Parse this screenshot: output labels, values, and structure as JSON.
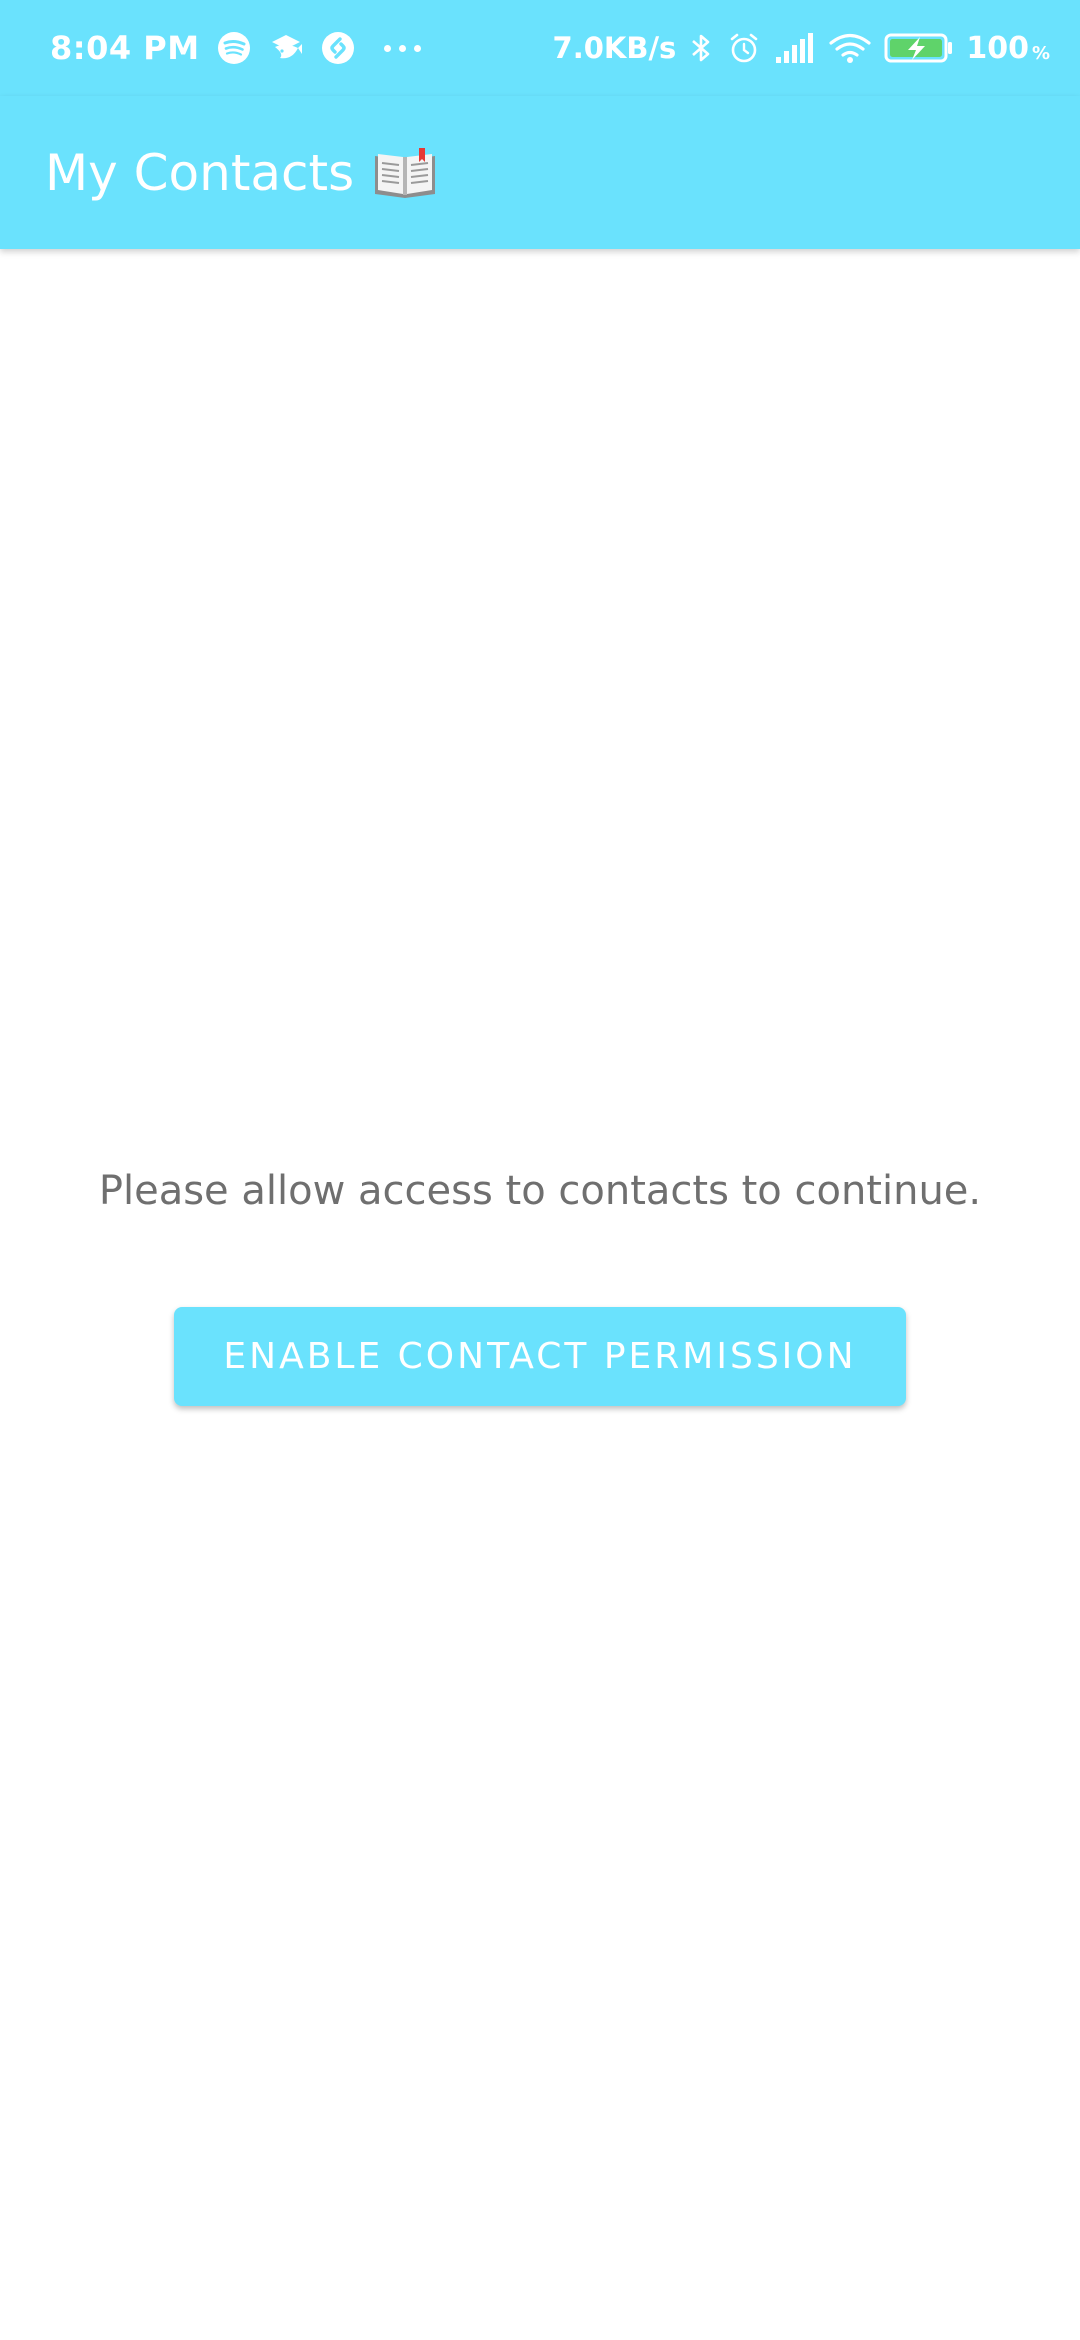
{
  "status_bar": {
    "time": "8:04 PM",
    "app_icons": [
      "spotify-icon",
      "fish-app-icon",
      "shazam-icon"
    ],
    "network_speed": "7.0KB/s",
    "battery_percent": "100",
    "battery_unit": "%"
  },
  "app_bar": {
    "title": "My Contacts",
    "title_icon": "open-book-icon"
  },
  "content": {
    "message": "Please allow access to contacts to continue.",
    "button_label": "ENABLE CONTACT PERMISSION"
  },
  "colors": {
    "primary": "#6ae2fd",
    "background": "#ffffff",
    "message_text": "#6f6f6f",
    "on_primary": "#ffffff"
  }
}
